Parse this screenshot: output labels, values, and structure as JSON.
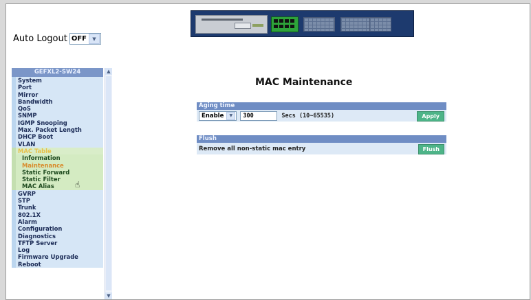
{
  "auto_logout": {
    "label": "Auto Logout",
    "value": "OFF"
  },
  "menu": {
    "title": "GEFXL2-SW24",
    "items": [
      {
        "label": "System"
      },
      {
        "label": "Port"
      },
      {
        "label": "Mirror"
      },
      {
        "label": "Bandwidth"
      },
      {
        "label": "QoS"
      },
      {
        "label": "SNMP"
      },
      {
        "label": "IGMP Snooping"
      },
      {
        "label": "Max. Packet Length"
      },
      {
        "label": "DHCP Boot"
      },
      {
        "label": "VLAN"
      },
      {
        "label": "MAC Table"
      },
      {
        "label": "Information"
      },
      {
        "label": "Maintenance"
      },
      {
        "label": "Static Forward"
      },
      {
        "label": "Static Filter"
      },
      {
        "label": "MAC Alias"
      },
      {
        "label": "GVRP"
      },
      {
        "label": "STP"
      },
      {
        "label": "Trunk"
      },
      {
        "label": "802.1X"
      },
      {
        "label": "Alarm"
      },
      {
        "label": "Configuration"
      },
      {
        "label": "Diagnostics"
      },
      {
        "label": "TFTP Server"
      },
      {
        "label": "Log"
      },
      {
        "label": "Firmware Upgrade"
      },
      {
        "label": "Reboot"
      }
    ]
  },
  "page": {
    "title": "MAC Maintenance"
  },
  "aging": {
    "header": "Aging time",
    "mode": "Enable",
    "value": "300",
    "hint": "Secs (10~65535)",
    "apply_label": "Apply"
  },
  "flush": {
    "header": "Flush",
    "text": "Remove all non-static mac entry",
    "button_label": "Flush"
  }
}
